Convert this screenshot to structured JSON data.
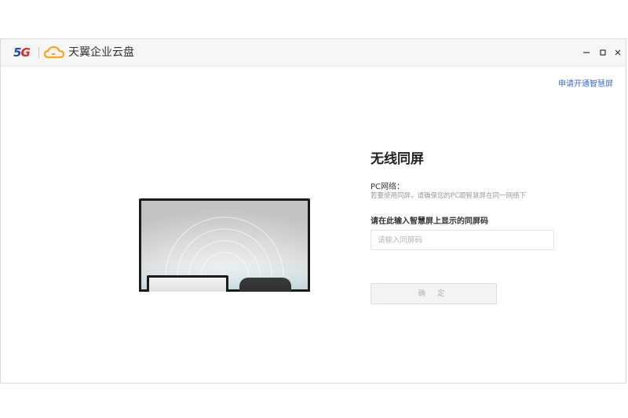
{
  "titlebar": {
    "brand_5": "5",
    "brand_g": "G",
    "app_name": "天翼企业云盘",
    "minimize_label": "—",
    "close_label": "✕"
  },
  "header": {
    "apply_link": "申请开通智慧屏"
  },
  "main": {
    "title": "无线同屏",
    "pc_network_label": "PC网络：",
    "pc_network_hint": "若要使用同屏，请确保您的PC跟智慧屏在同一网络下",
    "code_label": "请在此输入智慧屏上显示的同屏码",
    "code_input_value": "",
    "code_input_placeholder": "请输入同屏码",
    "confirm_label": "确 定"
  },
  "colors": {
    "brand_blue": "#1b4db5",
    "brand_red": "#e1251b",
    "cloud_orange": "#f5a623",
    "link_blue": "#3a6bd8"
  }
}
